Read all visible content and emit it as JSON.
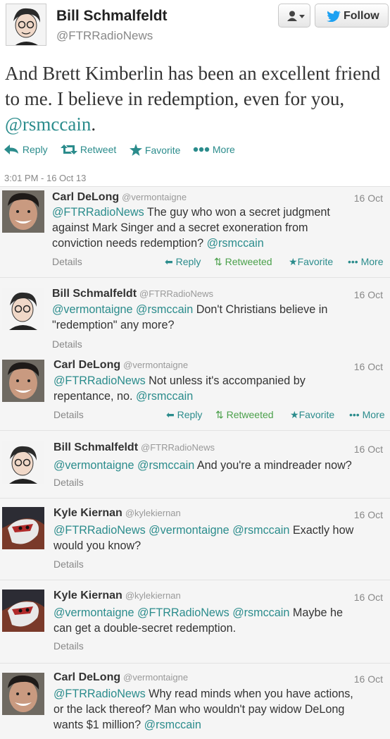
{
  "main_tweet": {
    "name": "Bill Schmalfeldt",
    "handle": "@FTRRadioNews",
    "follow_label": "Follow",
    "text_before": "And Brett Kimberlin has been an excellent friend to me. I believe in redemption, even for you, ",
    "mention": "@rsmccain",
    "text_after": ".",
    "actions": {
      "reply": "Reply",
      "retweet": "Retweet",
      "favorite": "Favorite",
      "more": "More"
    },
    "timestamp": "3:01 PM - 16 Oct 13"
  },
  "replies": [
    {
      "name": "Carl DeLong",
      "handle": "@vermontaigne",
      "date": "16 Oct",
      "line1": "@FTRRadioNews The guy who won a secret judgment",
      "line2": "against Mark Singer and a secret exoneration from",
      "line3": "conviction needs redemption? @rsmccain",
      "details": "Details",
      "actions": {
        "reply": "Reply",
        "retweet": "Retweeted",
        "favorite": "Favorite",
        "more": "More"
      }
    },
    {
      "name": "Bill Schmalfeldt",
      "handle": "@FTRRadioNews",
      "date": "16 Oct",
      "line1": "@vermontaigne @rsmccain Don't Christians believe in",
      "line2": "\"redemption\" any more?",
      "details": "Details"
    },
    {
      "name": "Carl DeLong",
      "handle": "@vermontaigne",
      "date": "16 Oct",
      "line1": "@FTRRadioNews Not unless it's accompanied by",
      "line2": "repentance, no. @rsmccain",
      "details": "Details",
      "actions": {
        "reply": "Reply",
        "retweet": "Retweeted",
        "favorite": "Favorite",
        "more": "More"
      }
    },
    {
      "name": "Bill Schmalfeldt",
      "handle": "@FTRRadioNews",
      "date": "16 Oct",
      "line1": "@vermontaigne @rsmccain And you're a mindreader now?",
      "details": "Details"
    },
    {
      "name": "Kyle Kiernan",
      "handle": "@kylekiernan",
      "date": "16 Oct",
      "line1": "@FTRRadioNews @vermontaigne @rsmccain Exactly how",
      "line2": "would you know?",
      "details": "Details"
    },
    {
      "name": "Kyle Kiernan",
      "handle": "@kylekiernan",
      "date": "16 Oct",
      "line1": "@vermontaigne @FTRRadioNews @rsmccain Maybe he",
      "line2": "can get a double-secret redemption.",
      "details": "Details"
    },
    {
      "name": "Carl DeLong",
      "handle": "@vermontaigne",
      "date": "16 Oct",
      "line1": "@FTRRadioNews Why read minds when you have actions,",
      "line2": "or the lack thereof? Man who wouldn't pay widow DeLong",
      "line3": "wants $1 million? @rsmccain"
    }
  ],
  "colors": {
    "link": "#2b8c8c",
    "retweeted": "#4aa04a",
    "muted": "#888888",
    "card_bg": "#f5f5f5"
  }
}
